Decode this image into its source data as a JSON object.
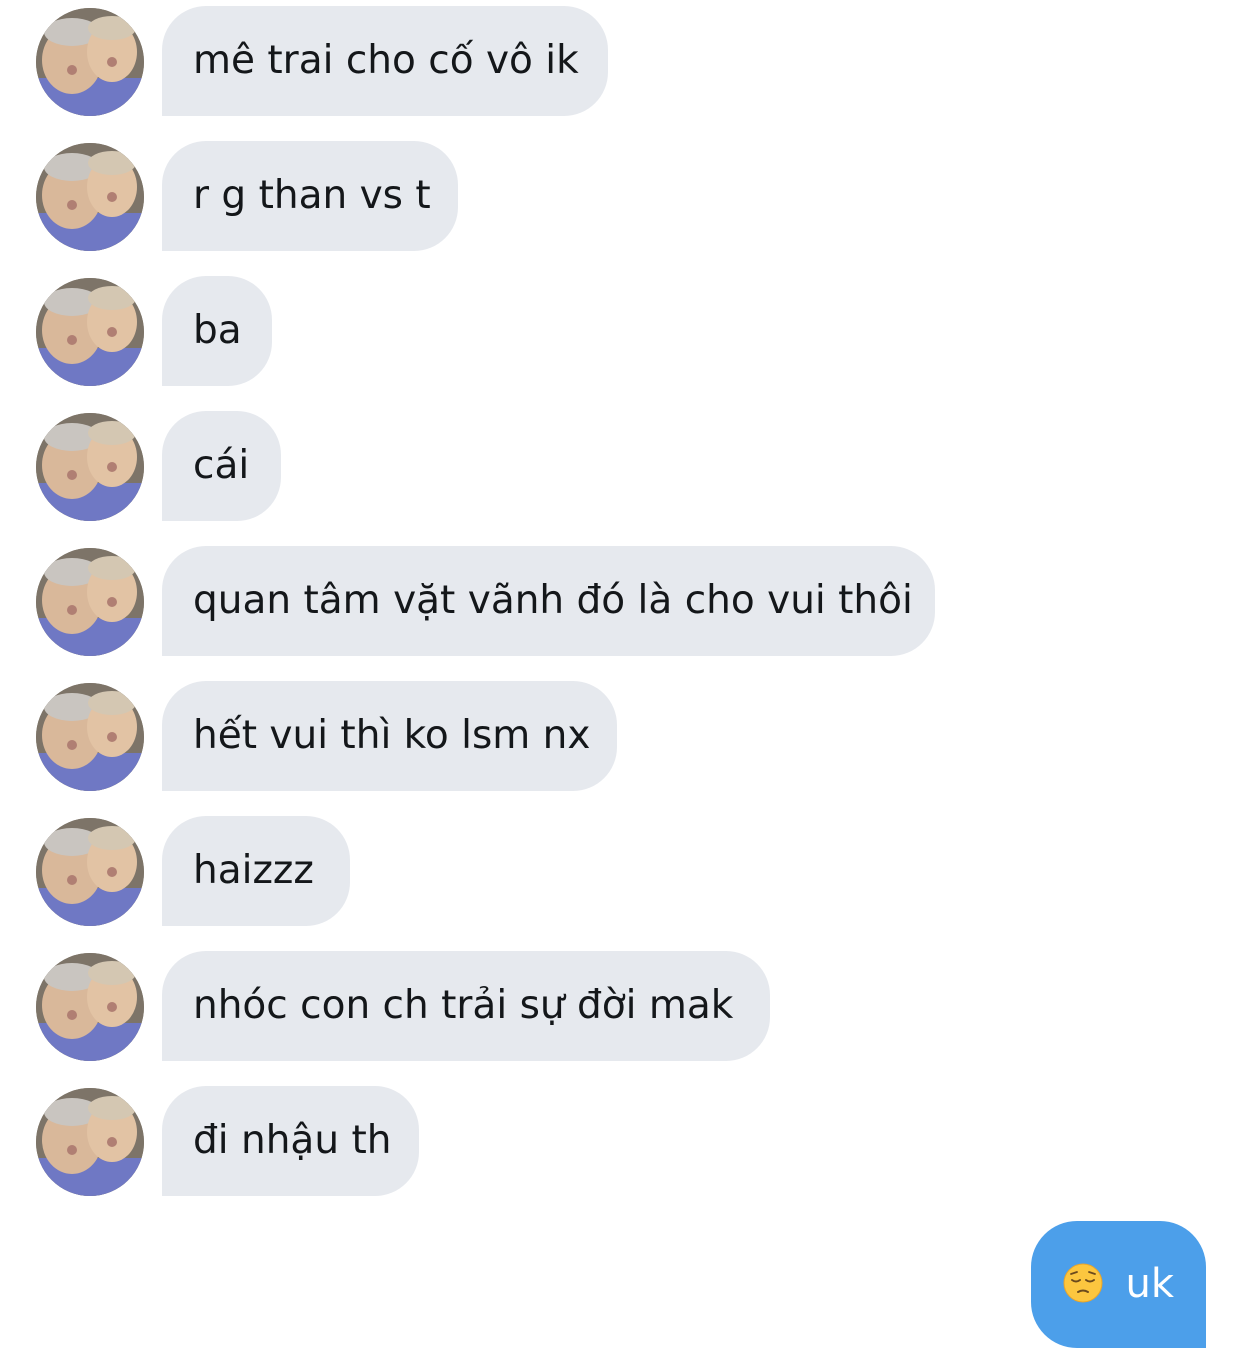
{
  "conversation": {
    "incoming": [
      {
        "text": "mê trai cho cố vô ik"
      },
      {
        "text": "r g than vs t"
      },
      {
        "text": "ba"
      },
      {
        "text": "cái"
      },
      {
        "text": "quan tâm vặt vãnh đó là cho vui thôi"
      },
      {
        "text": "hết vui thì ko lsm nx"
      },
      {
        "text": "haizzz"
      },
      {
        "text": "nhóc con ch trải sự đời mak"
      },
      {
        "text": "đi nhậu th"
      }
    ],
    "outgoing": [
      {
        "emoji": "pensive-face-emoji",
        "text": "uk"
      }
    ]
  },
  "colors": {
    "incoming_bubble": "#e6e9ee",
    "outgoing_bubble": "#4c9fea",
    "incoming_text": "#14171a",
    "outgoing_text": "#ffffff"
  }
}
